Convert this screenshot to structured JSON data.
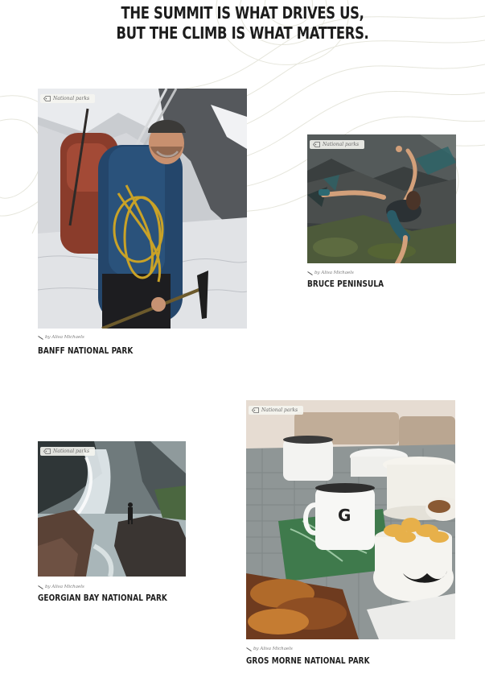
{
  "headline": {
    "line1": "THE SUMMIT IS WHAT DRIVES US,",
    "line2": "BUT THE CLIMB IS WHAT MATTERS."
  },
  "posts": [
    {
      "category": "National parks",
      "author": "by Alisa Michaels",
      "title": "BANFF NATIONAL PARK",
      "image": "hiker-with-backpack-and-ropes-on-glacier"
    },
    {
      "category": "National parks",
      "author": "by Alisa Michaels",
      "title": "BRUCE PENINSULA",
      "image": "woman-bouldering-on-rock-face"
    },
    {
      "category": "National parks",
      "author": "by Alisa Michaels",
      "title": "GEORGIAN BAY NATIONAL PARK",
      "image": "hiker-facing-waterfall-on-rocks"
    },
    {
      "category": "National parks",
      "author": "by Alisa Michaels",
      "title": "GROS MORNE NATIONAL PARK",
      "image": "enamel-mugs-and-snacks-on-picnic-table"
    }
  ],
  "icons": {
    "category": "tag-icon",
    "author": "pen-icon"
  },
  "colors": {
    "heading": "#1c1c1c",
    "tag_background": "#f5f5f0",
    "meta_text": "#7a7a7a",
    "topo_lines": "#e6e6dc"
  }
}
